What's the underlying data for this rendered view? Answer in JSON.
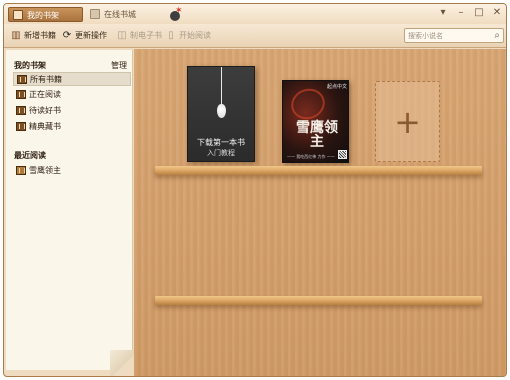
{
  "tabs": [
    {
      "label": "我的书架",
      "icon": "bookshelf-icon",
      "active": true
    },
    {
      "label": "在线书城",
      "icon": "bookstore-icon",
      "active": false
    }
  ],
  "window_controls": {
    "dropdown": "▾",
    "minimize": "–",
    "maximize": "□",
    "close": "✕"
  },
  "toolbar": {
    "add_books": {
      "label": "新增书籍",
      "icon": "add-book-icon"
    },
    "update": {
      "label": "更新操作",
      "icon": "update-icon"
    },
    "transfer": {
      "label": "制电子书",
      "icon": "box-icon",
      "enabled": false
    },
    "start_reading": {
      "label": "开始阅读",
      "icon": "read-icon",
      "enabled": false
    }
  },
  "search": {
    "placeholder": "搜索小说名",
    "icon": "search-icon"
  },
  "sidebar": {
    "my_shelf_heading": "我的书架",
    "manage_label": "管理",
    "items": [
      {
        "label": "所有书籍",
        "selected": true
      },
      {
        "label": "正在阅读",
        "selected": false
      },
      {
        "label": "待读好书",
        "selected": false
      },
      {
        "label": "精典藏书",
        "selected": false
      }
    ],
    "recent_heading": "最近阅读",
    "recent_items": [
      {
        "label": "雪鹰领主"
      }
    ]
  },
  "books": [
    {
      "title_line1": "下载第一本书",
      "title_line2": "入门教程"
    },
    {
      "publisher": "起点中文",
      "title": "雪鹰领主",
      "author": "—— 我吃西红柿 力作 ——"
    }
  ],
  "add_book_symbol": "+",
  "colors": {
    "accent": "#a9733f",
    "wood": "#d8a572",
    "shelf_board": "#e2ad6e",
    "sidebar_bg": "#fbf6ea"
  }
}
